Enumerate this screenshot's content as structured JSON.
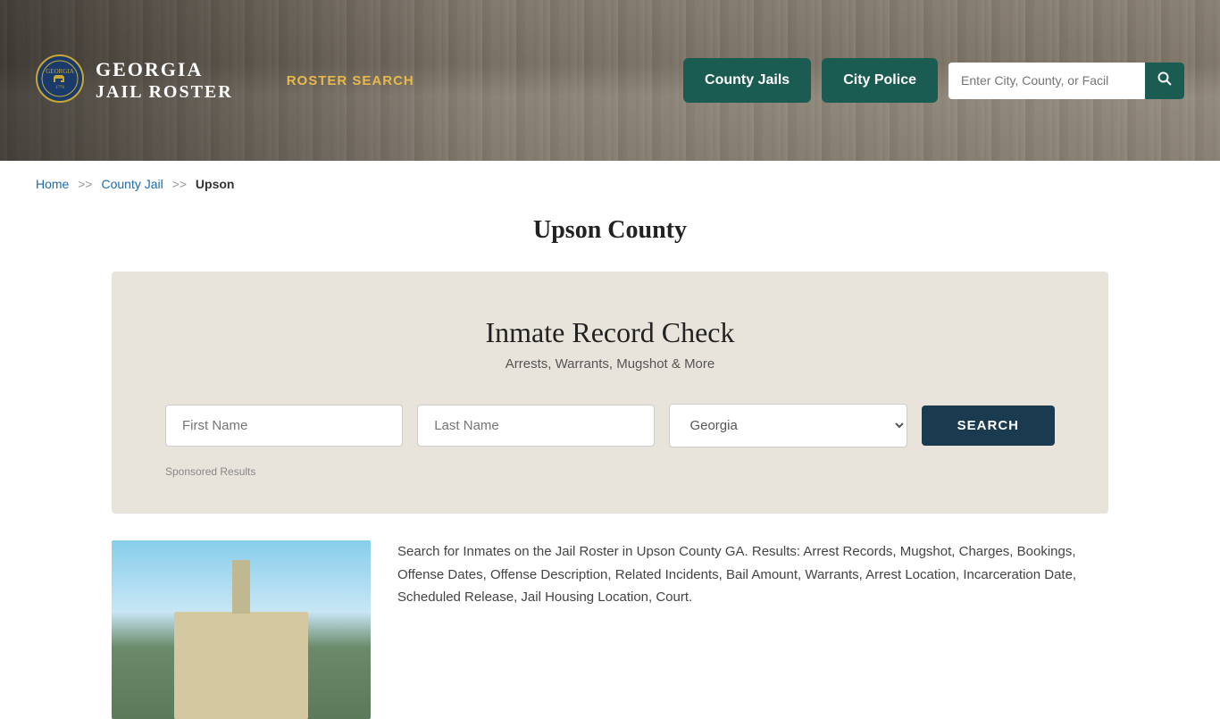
{
  "header": {
    "logo_line1": "GEORGIA",
    "logo_line2": "JAIL ROSTER",
    "nav_label": "ROSTER SEARCH",
    "btn_county": "County Jails",
    "btn_city": "City Police",
    "search_placeholder": "Enter City, County, or Facil"
  },
  "breadcrumb": {
    "home": "Home",
    "sep1": ">>",
    "county_jail": "County Jail",
    "sep2": ">>",
    "current": "Upson"
  },
  "page_title": "Upson County",
  "inmate_section": {
    "title": "Inmate Record Check",
    "subtitle": "Arrests, Warrants, Mugshot & More",
    "first_name_placeholder": "First Name",
    "last_name_placeholder": "Last Name",
    "state_default": "Georgia",
    "search_btn": "SEARCH",
    "sponsored": "Sponsored Results"
  },
  "bottom": {
    "description": "Search for Inmates on the Jail Roster in Upson County GA. Results: Arrest Records, Mugshot, Charges, Bookings, Offense Dates, Offense Description, Related Incidents, Bail Amount, Warrants, Arrest Location, Incarceration Date, Scheduled Release, Jail Housing Location, Court."
  }
}
